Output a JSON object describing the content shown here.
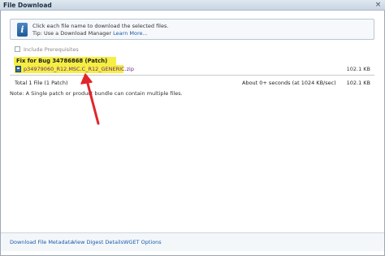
{
  "window": {
    "title": "File Download",
    "close_glyph": "×"
  },
  "info": {
    "icon": "info-icon",
    "line1": "Click each file name to download the selected files.",
    "tip_prefix": "Tip: Use a Download Manager",
    "learn_more": "Learn More..."
  },
  "prereq": {
    "label": "Include Prerequisites",
    "checked": false
  },
  "patch": {
    "title": "Fix for Bug 34786868 (Patch)",
    "file_name": "p34979060_R12.MSC.C_R12_GENERIC.zip",
    "file_size": "102.1 KB"
  },
  "summary": {
    "total": "Total 1 File (1 Patch)",
    "time": "About 0+ seconds (at 1024 KB/sec)",
    "size": "102.1 KB"
  },
  "note": "Note: A Single patch or product bundle can contain multiple files.",
  "footer": {
    "metadata": "Download File Metadata",
    "digest": "View Digest Details",
    "wget": "WGET Options"
  },
  "colors": {
    "highlight": "#f6ee43",
    "arrow": "#e0262b",
    "link": "#1a5aa8",
    "file_link": "#6a2a86"
  }
}
